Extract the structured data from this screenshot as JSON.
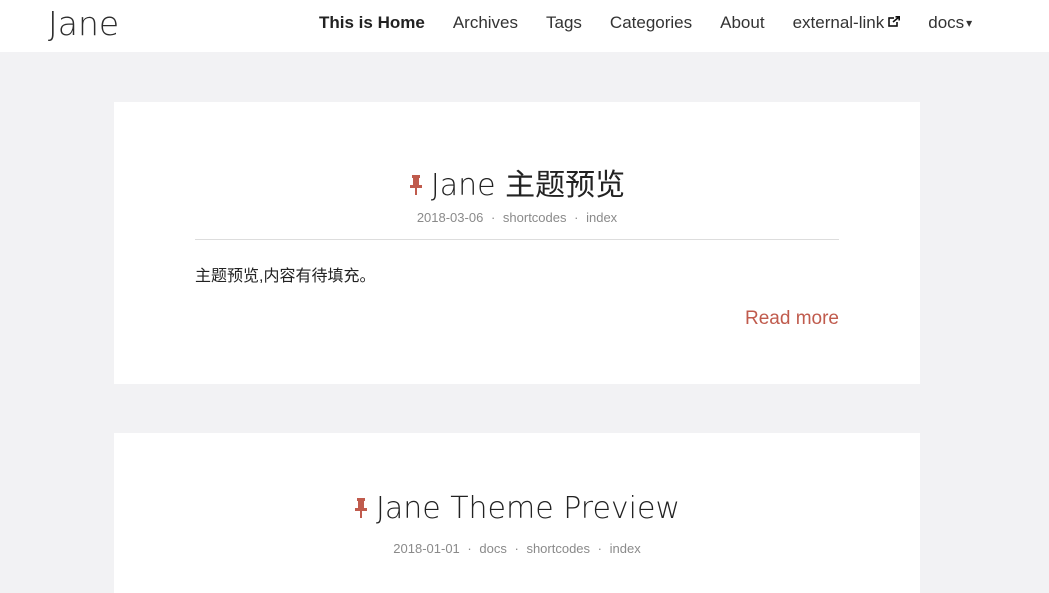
{
  "site": {
    "title": "Jane"
  },
  "nav": [
    {
      "label": "This is Home",
      "active": true
    },
    {
      "label": "Archives"
    },
    {
      "label": "Tags"
    },
    {
      "label": "Categories"
    },
    {
      "label": "About"
    },
    {
      "label": "external-link",
      "icon": "external-link-icon"
    },
    {
      "label": "docs",
      "icon": "caret-down-icon"
    }
  ],
  "posts": [
    {
      "title": "Jane 主题预览",
      "pinned": true,
      "date": "2018-03-06",
      "categories": [
        "shortcodes",
        "index"
      ],
      "summary": "主题预览,内容有待填充。",
      "read_more": "Read more"
    },
    {
      "title": "Jane Theme Preview",
      "pinned": true,
      "date": "2018-01-01",
      "categories": [
        "docs",
        "shortcodes",
        "index"
      ]
    }
  ],
  "colors": {
    "accent": "#c05b4d",
    "background": "#f2f2f4"
  },
  "meta_separator": "·",
  "caret_glyph": "▾"
}
